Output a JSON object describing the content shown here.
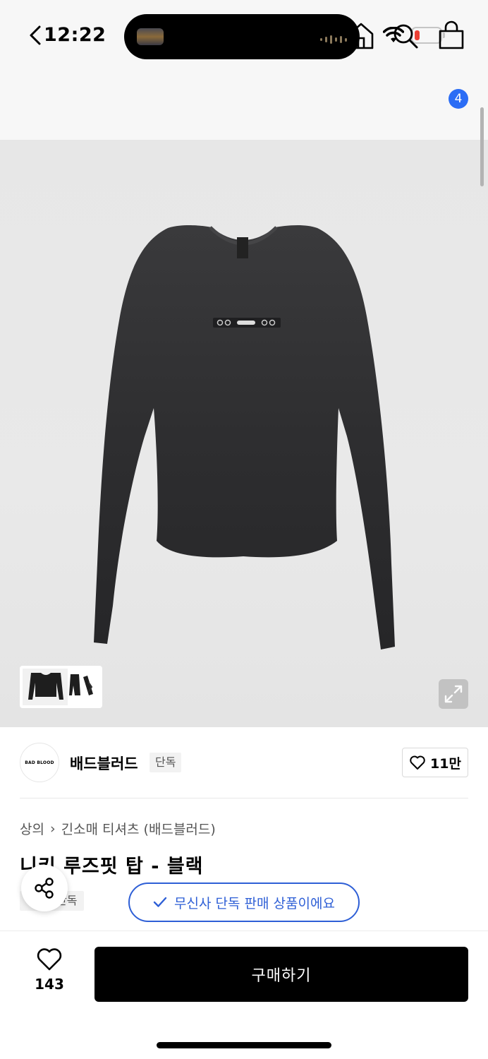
{
  "status_bar": {
    "time": "12:22"
  },
  "nav": {
    "cart_count": "4"
  },
  "brand": {
    "logo_text": "BAD BLOOD",
    "name": "배드블러드",
    "tag": "단독",
    "like_count": "11만"
  },
  "breadcrumb": {
    "category": "상의",
    "separator": "›",
    "subcategory": "긴소매 티셔츠 (배드블러드)"
  },
  "product": {
    "title": "니키 루즈핏 탑 - 블랙",
    "tag": "단독"
  },
  "exclusive_notice": "무신사 단독 판매 상품이에요",
  "bottom": {
    "wish_count": "143",
    "buy_label": "구매하기"
  },
  "colors": {
    "accent_blue": "#2b6df5",
    "notice_blue": "#2e5fd6",
    "buy_bg": "#000000"
  }
}
